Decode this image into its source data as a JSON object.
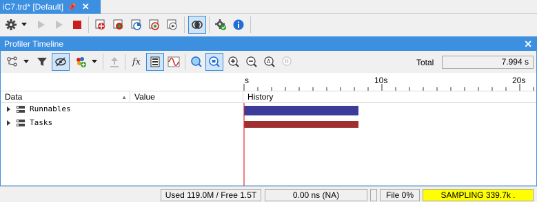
{
  "document_tab": {
    "title": "iC7.trd* [Default]",
    "pin_icon": "pin-icon",
    "close_glyph": "✕"
  },
  "main_toolbar": {
    "buttons": [
      "settings-gear-icon",
      "dropdown-arrow-icon",
      "play-icon",
      "step-icon",
      "stop-icon",
      "record-target-icon",
      "add-target-icon",
      "timing-analysis-icon",
      "coverage-icon",
      "export-icon",
      "link-toggle-icon",
      "options-gear-icon",
      "info-icon"
    ]
  },
  "panel": {
    "title": "Profiler Timeline",
    "close_glyph": "✕",
    "toolbar": {
      "buttons": [
        "hierarchy-icon",
        "dropdown-arrow-icon",
        "filter-icon",
        "hide-toggle-icon",
        "add-variable-icon",
        "dropdown-arrow-icon",
        "upload-icon",
        "function-fx-icon",
        "list-view-icon",
        "signal-wave-icon",
        "search-icon",
        "zoom-fit-icon",
        "zoom-in-icon",
        "zoom-out-icon",
        "zoom-auto-icon",
        "pause-icon"
      ],
      "function_glyph": "fx"
    },
    "total_label": "Total",
    "total_value": "7.994 s"
  },
  "timeline": {
    "ruler_labels": [
      "s",
      "10s",
      "20s"
    ],
    "cursor_color": "#e03030"
  },
  "grid": {
    "columns": {
      "data": "Data",
      "value": "Value",
      "history": "History"
    },
    "rows": [
      {
        "label": "Runnables",
        "bar_color": "#3b3b9a",
        "end_seconds": 8.0
      },
      {
        "label": "Tasks",
        "bar_color": "#a03030",
        "end_seconds": 8.0
      }
    ]
  },
  "statusbar": {
    "memory": "Used 119.0M / Free 1.5T",
    "time": "0.00 ns (NA)",
    "file": "File 0%",
    "sampling": "SAMPLING 339.7k  .",
    "sampling_bg": "#ffff00"
  }
}
